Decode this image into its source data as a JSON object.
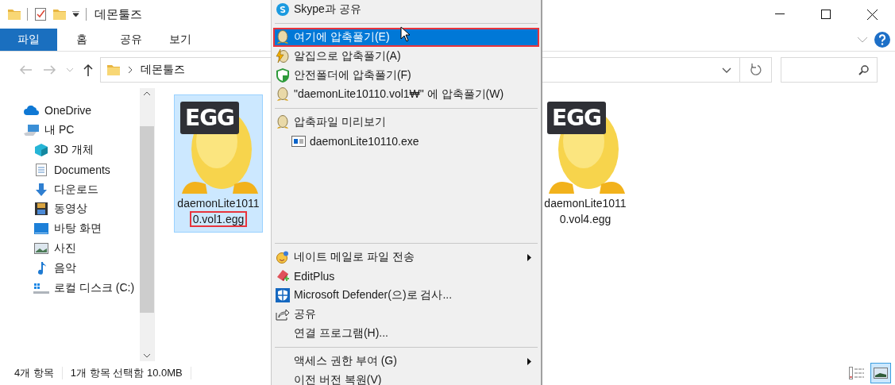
{
  "window": {
    "title": "데몬툴즈"
  },
  "ribbon": {
    "tabs": [
      {
        "label": "파일",
        "selected": true
      },
      {
        "label": "홈",
        "selected": false
      },
      {
        "label": "공유",
        "selected": false
      },
      {
        "label": "보기",
        "selected": false
      }
    ]
  },
  "address": {
    "path": [
      "데몬툴즈"
    ]
  },
  "sidebar": {
    "items": [
      {
        "label": "OneDrive"
      },
      {
        "label": "내 PC",
        "children": [
          {
            "label": "3D 개체"
          },
          {
            "label": "Documents"
          },
          {
            "label": "다운로드"
          },
          {
            "label": "동영상"
          },
          {
            "label": "바탕 화면"
          },
          {
            "label": "사진"
          },
          {
            "label": "음악"
          },
          {
            "label": "로컬 디스크 (C:)"
          }
        ]
      }
    ]
  },
  "files": [
    {
      "badge": "EGG",
      "name_lines": [
        "daemonLite1011",
        "0.vol1.egg"
      ],
      "selected": true,
      "annotated": true
    },
    {
      "badge": "EGG",
      "name_lines": [
        "daemonLite1011",
        "0.vol4.egg"
      ],
      "selected": false,
      "annotated": false
    }
  ],
  "context_menu": {
    "items": [
      {
        "kind": "item",
        "label": "Skype과 공유",
        "selected": false,
        "annotated": false,
        "submenu": false
      },
      {
        "kind": "separator"
      },
      {
        "kind": "item",
        "label": "여기에 압축풀기(E)",
        "selected": true,
        "annotated": true,
        "submenu": false
      },
      {
        "kind": "item",
        "label": "알집으로 압축풀기(A)",
        "selected": false,
        "annotated": false,
        "submenu": false
      },
      {
        "kind": "item",
        "label": "안전폴더에 압축풀기(F)",
        "selected": false,
        "annotated": false,
        "submenu": false
      },
      {
        "kind": "item",
        "label": "\"daemonLite10110.vol1₩\" 에 압축풀기(W)",
        "selected": false,
        "annotated": false,
        "submenu": false
      },
      {
        "kind": "separator"
      },
      {
        "kind": "item",
        "label": "압축파일 미리보기",
        "selected": false,
        "annotated": false,
        "submenu": false
      },
      {
        "kind": "subitem",
        "label": "daemonLite10110.exe",
        "selected": false,
        "annotated": false,
        "submenu": false
      },
      {
        "kind": "separator"
      },
      {
        "kind": "item",
        "label": "네이트 메일로 파일 전송",
        "selected": false,
        "annotated": false,
        "submenu": true
      },
      {
        "kind": "item",
        "label": "EditPlus",
        "selected": false,
        "annotated": false,
        "submenu": false
      },
      {
        "kind": "item",
        "label": "Microsoft Defender(으)로 검사...",
        "selected": false,
        "annotated": false,
        "submenu": false
      },
      {
        "kind": "item",
        "label": "공유",
        "selected": false,
        "annotated": false,
        "submenu": false
      },
      {
        "kind": "item",
        "label": "연결 프로그램(H)...",
        "selected": false,
        "annotated": false,
        "submenu": false
      },
      {
        "kind": "separator"
      },
      {
        "kind": "item",
        "label": "액세스 권한 부여 (G)",
        "selected": false,
        "annotated": false,
        "submenu": true
      },
      {
        "kind": "item",
        "label": "이전 버전 복원(V)",
        "selected": false,
        "annotated": false,
        "submenu": false
      }
    ]
  },
  "status_bar": {
    "item_count": "4개 항목",
    "selection": "1개 항목 선택함 10.0MB",
    "views": [
      {
        "selected": false
      },
      {
        "selected": true
      }
    ]
  }
}
